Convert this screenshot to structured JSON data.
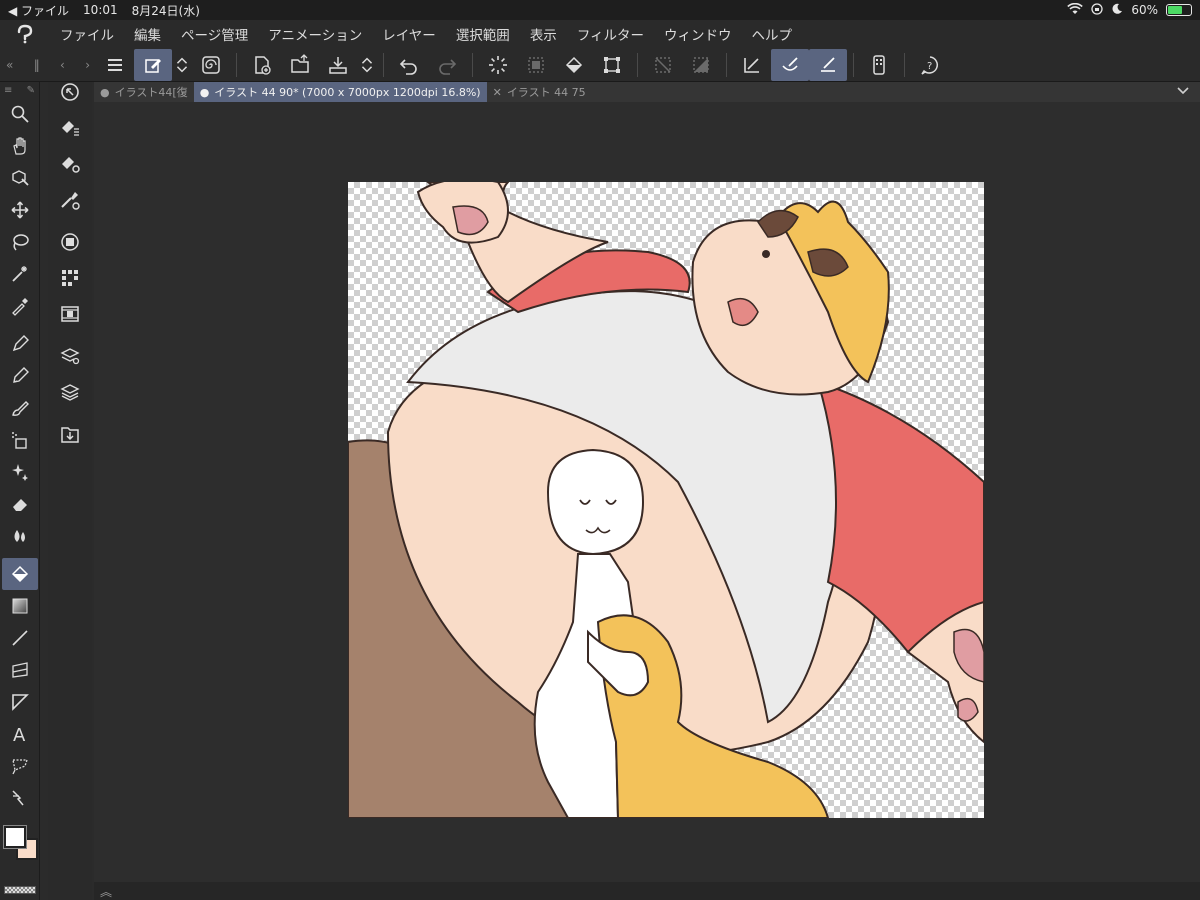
{
  "status_bar": {
    "back_label": "◀ ファイル",
    "time": "10:01",
    "date": "8月24日(水)",
    "battery": "60%",
    "battery_level": 0.6
  },
  "menu": {
    "items": [
      "ファイル",
      "編集",
      "ページ管理",
      "アニメーション",
      "レイヤー",
      "選択範囲",
      "表示",
      "フィルター",
      "ウィンドウ",
      "ヘルプ"
    ]
  },
  "tabs": [
    {
      "label": "イラスト44[復",
      "marker": "●"
    },
    {
      "label": "イラスト 44 90* (7000 x 7000px 1200dpi 16.8%)",
      "marker": "●"
    },
    {
      "label": "イラスト 44 75",
      "marker": "✕"
    }
  ],
  "colors": {
    "accent": "#5a6580",
    "main_color": "#ffffff",
    "sub_color": "#f9dcc8"
  },
  "icons": {
    "toolbar": [
      "menu-icon",
      "new-canvas-icon",
      "swap-icon",
      "spiral-icon",
      "new-file-icon",
      "open-folder-icon",
      "save-icon",
      "save-stepper-icon",
      "undo-icon",
      "redo-icon",
      "loading-icon",
      "select-all-icon",
      "fill-icon",
      "transform-icon",
      "clear-selection-icon",
      "invert-icon",
      "ruler-icon",
      "brush-active-icon",
      "pen-snap-icon",
      "device-icon",
      "help-icon"
    ]
  }
}
